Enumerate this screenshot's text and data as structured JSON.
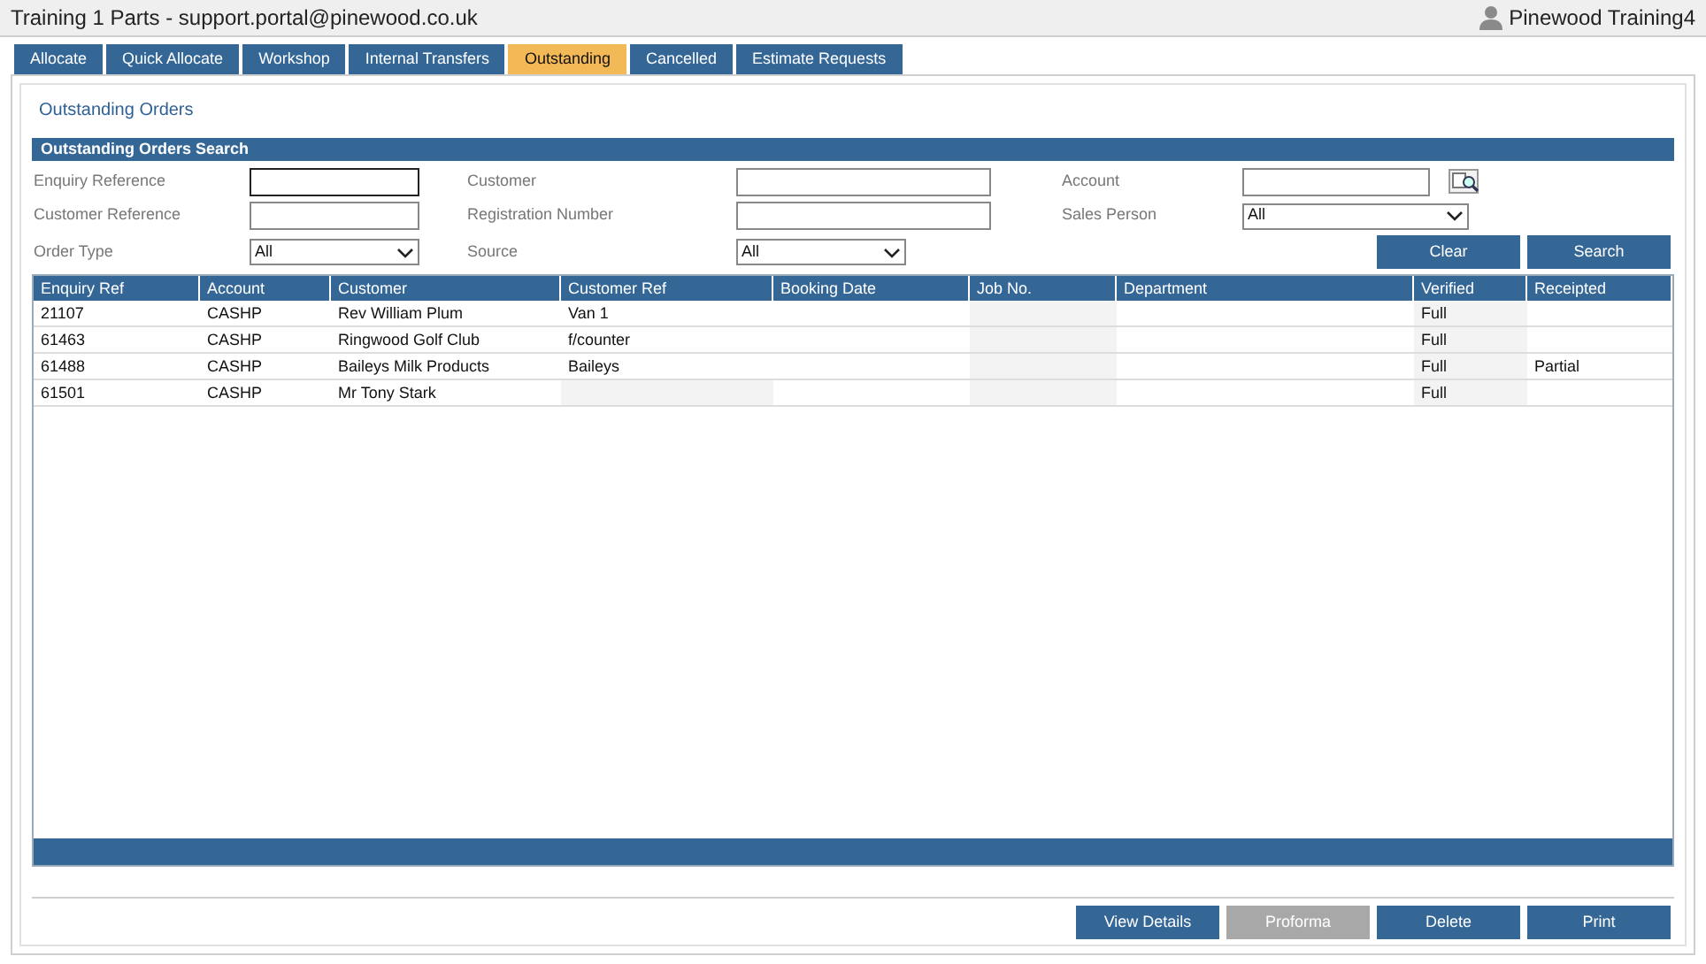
{
  "window": {
    "title": "Training 1 Parts - support.portal@pinewood.co.uk",
    "user": "Pinewood Training4"
  },
  "tabs": [
    {
      "label": "Allocate",
      "selected": false
    },
    {
      "label": "Quick Allocate",
      "selected": false
    },
    {
      "label": "Workshop",
      "selected": false
    },
    {
      "label": "Internal Transfers",
      "selected": false
    },
    {
      "label": "Outstanding",
      "selected": true
    },
    {
      "label": "Cancelled",
      "selected": false
    },
    {
      "label": "Estimate Requests",
      "selected": false
    }
  ],
  "page_title": "Outstanding Orders",
  "search": {
    "title": "Outstanding Orders Search",
    "fields": [
      {
        "label": "Enquiry Reference",
        "kind": "text"
      },
      {
        "label": "Customer",
        "kind": "text"
      },
      {
        "label": "Account",
        "kind": "lookup"
      },
      {
        "label": "Customer Reference",
        "kind": "text"
      },
      {
        "label": "Registration Number",
        "kind": "text"
      },
      {
        "label": "Sales Person",
        "kind": "select",
        "value": "All"
      },
      {
        "label": "Order Type",
        "kind": "select",
        "value": "All"
      },
      {
        "label": "Source",
        "kind": "select",
        "value": "All"
      }
    ],
    "buttons": [
      "Clear",
      "Search"
    ]
  },
  "table": {
    "columns": [
      "Enquiry Ref",
      "Account",
      "Customer",
      "Customer Ref",
      "Booking Date",
      "Job No.",
      "Department",
      "Verified",
      "Receipted"
    ],
    "rows": [
      [
        "21107",
        "CASHP",
        "Rev William Plum",
        "Van 1",
        "",
        "",
        "",
        "Full",
        ""
      ],
      [
        "61463",
        "CASHP",
        "Ringwood Golf Club",
        "f/counter",
        "",
        "",
        "",
        "Full",
        ""
      ],
      [
        "61488",
        "CASHP",
        "Baileys Milk Products",
        "Baileys",
        "",
        "",
        "",
        "Full",
        "Partial"
      ],
      [
        "61501",
        "CASHP",
        "Mr Tony Stark",
        "",
        "",
        "",
        "",
        "Full",
        ""
      ]
    ]
  },
  "buttons": [
    {
      "label": "View Details",
      "disabled": false
    },
    {
      "label": "Proforma",
      "disabled": true
    },
    {
      "label": "Delete",
      "disabled": false
    },
    {
      "label": "Print",
      "disabled": false
    }
  ]
}
